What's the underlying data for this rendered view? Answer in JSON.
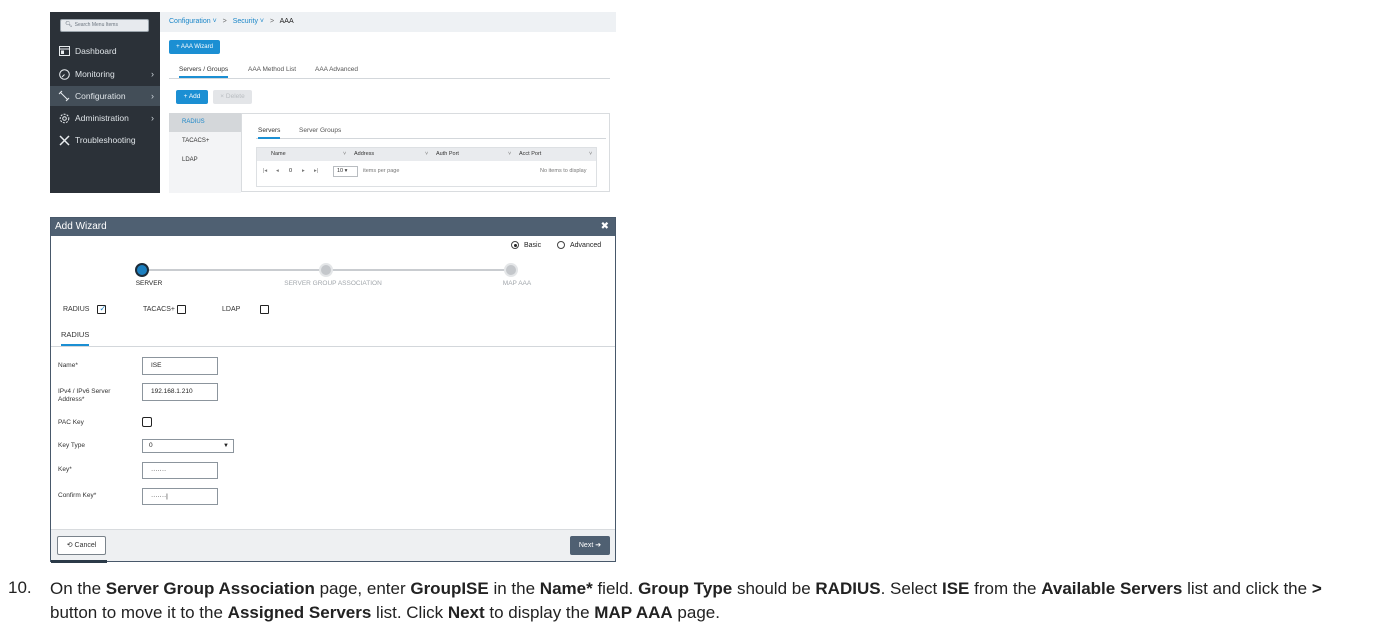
{
  "sidebar": {
    "search_placeholder": "Search Menu Items",
    "items": [
      {
        "label": "Dashboard",
        "icon": "dashboard-icon"
      },
      {
        "label": "Monitoring",
        "icon": "monitoring-icon"
      },
      {
        "label": "Configuration",
        "icon": "configuration-icon"
      },
      {
        "label": "Administration",
        "icon": "administration-icon"
      },
      {
        "label": "Troubleshooting",
        "icon": "troubleshooting-icon"
      }
    ]
  },
  "breadcrumb": {
    "item1": "Configuration",
    "item2": "Security",
    "current": "AAA"
  },
  "aaa": {
    "wizard_button": "+ AAA Wizard",
    "tabs": [
      "Servers / Groups",
      "AAA Method List",
      "AAA Advanced"
    ],
    "add_button": "+ Add",
    "delete_button": "× Delete",
    "protocols": [
      "RADIUS",
      "TACACS+",
      "LDAP"
    ],
    "server_tabs": [
      "Servers",
      "Server Groups"
    ],
    "columns": [
      "Name",
      "Address",
      "Auth Port",
      "Acct Port"
    ],
    "pager": {
      "page": "0",
      "per_page": "10",
      "per_page_label": "items per page",
      "empty": "No items to display"
    }
  },
  "wizard": {
    "title": "Add Wizard",
    "mode_basic": "Basic",
    "mode_advanced": "Advanced",
    "steps": [
      "SERVER",
      "SERVER GROUP ASSOCIATION",
      "MAP AAA"
    ],
    "protocols": [
      {
        "label": "RADIUS",
        "checked": true
      },
      {
        "label": "TACACS+",
        "checked": false
      },
      {
        "label": "LDAP",
        "checked": false
      }
    ],
    "active_tab": "RADIUS",
    "fields": {
      "name_label": "Name*",
      "name_value": "ISE",
      "address_label": "IPv4 / IPv6 Server Address*",
      "address_value": "192.168.1.210",
      "pac_label": "PAC Key",
      "keytype_label": "Key Type",
      "keytype_value": "0",
      "key_label": "Key*",
      "key_value": "·······",
      "confirm_label": "Confirm Key*",
      "confirm_value": "·······|"
    },
    "cancel_button": "Cancel",
    "next_button": "Next"
  },
  "instruction": {
    "number": "10.",
    "t1": "On the ",
    "b1": "Server Group Association",
    "t2": " page, enter ",
    "b2": "GroupISE",
    "t3": " in the ",
    "b3": "Name*",
    "t4": " field. ",
    "b4": "Group Type",
    "t5": " should be ",
    "b5": "RADIUS",
    "t6": ". Select ",
    "b6": "ISE",
    "t7": " from the ",
    "b7": "Available Servers",
    "t8": " list and click the ",
    "b8": ">",
    "t9": " button to move it to the ",
    "b9": "Assigned Servers",
    "t10": " list. Click ",
    "b10": "Next",
    "t11": " to display the ",
    "b11": "MAP AAA",
    "t12": " page."
  }
}
